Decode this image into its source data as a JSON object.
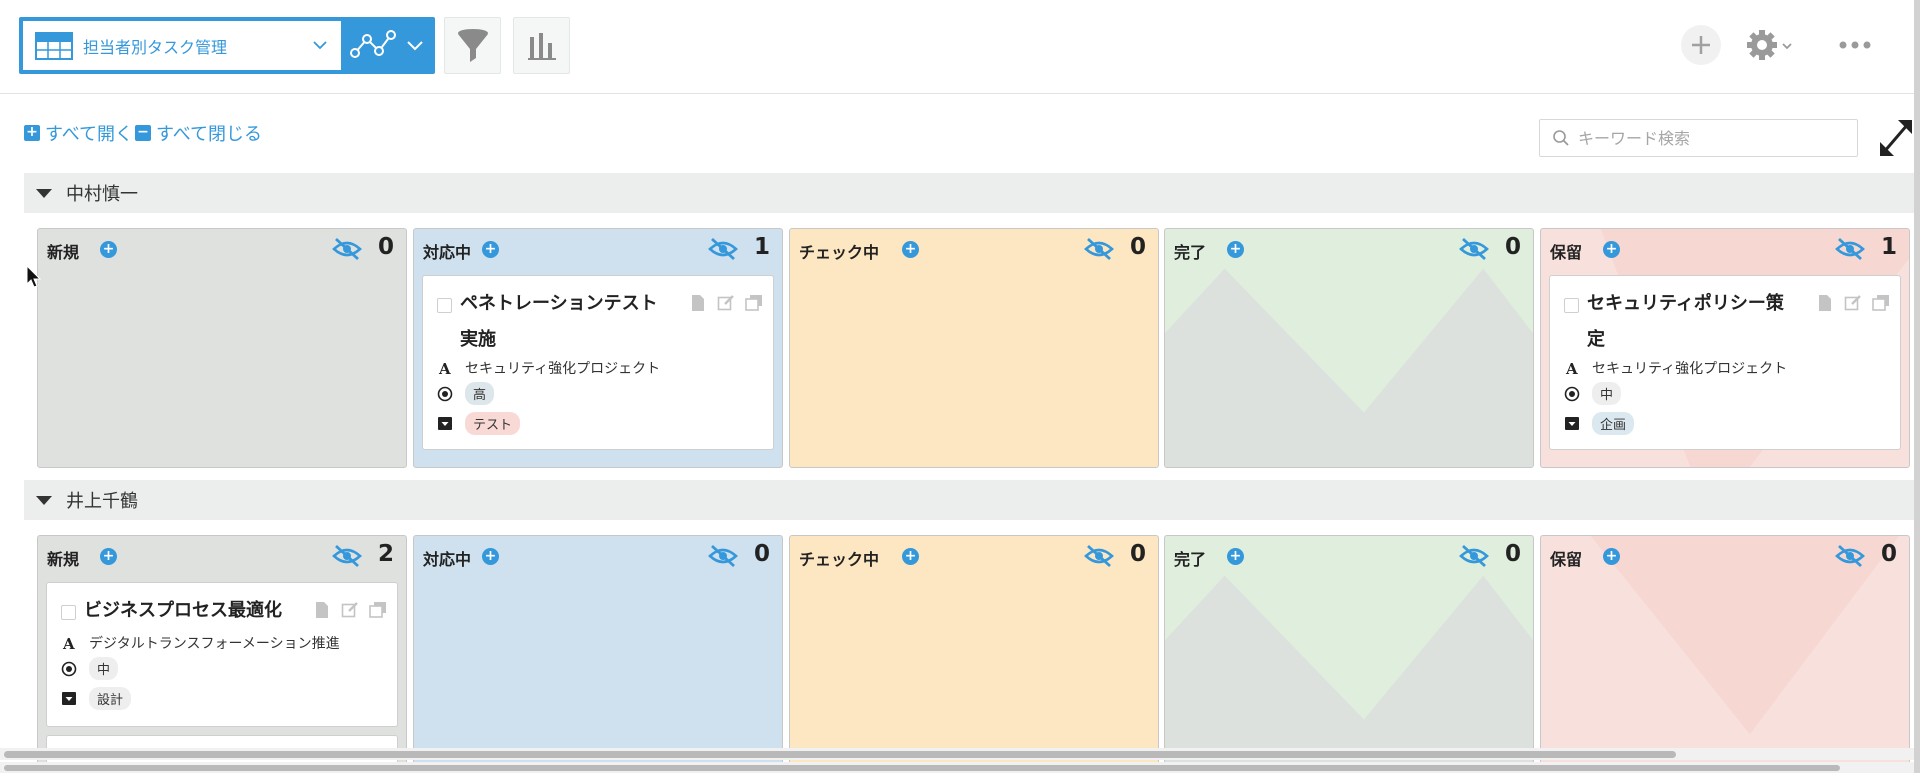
{
  "toolbar": {
    "view_name": "担当者別タスク管理",
    "icons": [
      "table-icon",
      "chevron-down-icon",
      "graph-icon",
      "filter-icon",
      "bar-chart-icon",
      "plus-icon",
      "gear-icon",
      "more-icon"
    ]
  },
  "controls": {
    "expand_all": "すべて開く",
    "collapse_all": "すべて閉じる",
    "search_placeholder": "キーワード検索"
  },
  "colors": {
    "accent": "#3498db",
    "lane_new": "#dfe1df",
    "lane_in_progress": "#cfe0ee",
    "lane_checking": "#fde7c2",
    "lane_done": "#dfeedd",
    "lane_hold": "#f8e1dd"
  },
  "groups": [
    {
      "name": "中村慎一",
      "lanes": [
        {
          "title": "新規",
          "count": "0",
          "cards": []
        },
        {
          "title": "対応中",
          "count": "1",
          "cards": [
            {
              "title_line1": "ペネトレーションテスト",
              "title_line2": "実施",
              "project": "セキュリティ強化プロジェクト",
              "priority": "高",
              "category": "テスト"
            }
          ]
        },
        {
          "title": "チェック中",
          "count": "0",
          "cards": []
        },
        {
          "title": "完了",
          "count": "0",
          "cards": []
        },
        {
          "title": "保留",
          "count": "1",
          "cards": [
            {
              "title_line1": "セキュリティポリシー策",
              "title_line2": "定",
              "project": "セキュリティ強化プロジェクト",
              "priority": "中",
              "category": "企画"
            }
          ]
        }
      ]
    },
    {
      "name": "井上千鶴",
      "lanes": [
        {
          "title": "新規",
          "count": "2",
          "cards": [
            {
              "title_line1": "ビジネスプロセス最適化",
              "project": "デジタルトランスフォーメーション推進",
              "priority": "中",
              "category": "設計"
            }
          ]
        },
        {
          "title": "対応中",
          "count": "0",
          "cards": []
        },
        {
          "title": "チェック中",
          "count": "0",
          "cards": []
        },
        {
          "title": "完了",
          "count": "0",
          "cards": []
        },
        {
          "title": "保留",
          "count": "0",
          "cards": []
        }
      ]
    }
  ]
}
